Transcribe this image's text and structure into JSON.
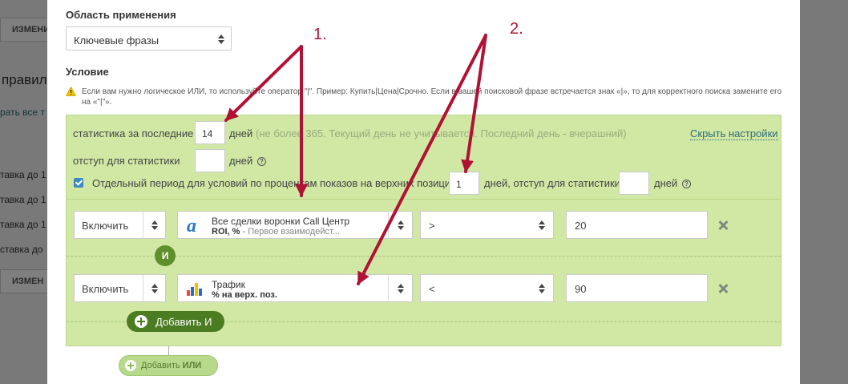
{
  "background": {
    "button_top": "ИЗМЕНИ",
    "heading_fragment": "правил",
    "link_fragment": "рать все т",
    "rows": [
      "тавка до 1",
      "тавка до 1",
      "тавка до 1",
      "ставка до"
    ],
    "button_bottom": "ИЗМЕН"
  },
  "scope": {
    "title": "Область применения",
    "selected": "Ключевые фразы"
  },
  "condition": {
    "title": "Условие",
    "warning": "Если вам нужно логическое ИЛИ, то используйте оператор \"|\". Пример: Купить|Цена|Срочно. Если в вашей поисковой фразе встречается знак «|», то для корректного поиска замените его на «\"|\"»."
  },
  "settings": {
    "stats_label": "статистика за последние",
    "stats_value": "14",
    "days": "дней",
    "stats_hint": "(не более 365. Текущий день не учитывается. Последний день - вчерашний)",
    "hide_link": "Скрыть настройки",
    "offset_label": "отступ для статистики",
    "offset_value": "",
    "help_glyph": "?",
    "separate_checked": true,
    "separate_label": "Отдельный период для условий по процентам показов на верхних позициях",
    "separate_value": "1",
    "separate_days_offset": "дней, отступ для статистики",
    "separate_offset_value": ""
  },
  "rows": [
    {
      "action": "Включить",
      "metric_name": "Все сделки воронки Call Центр",
      "metric_unit": "ROI, %",
      "metric_desc": "- Первое взаимодейст...",
      "metric_icon": "alpha-a-icon",
      "operator": ">",
      "value": "20"
    },
    {
      "action": "Включить",
      "metric_name": "Трафик",
      "metric_unit": "% на верх. поз.",
      "metric_desc": "",
      "metric_icon": "bar-chart-icon",
      "operator": "<",
      "value": "90"
    }
  ],
  "and_badge": "И",
  "add_and": "Добавить И",
  "add_or_prefix": "Добавить ",
  "add_or_bold": "ИЛИ",
  "annotations": [
    "1.",
    "2."
  ],
  "colors": {
    "panel": "#d0e8a4",
    "button_green": "#4b7c22",
    "annotation": "#b01235",
    "link": "#2e6b7a",
    "checkbox": "#3f88c5"
  }
}
